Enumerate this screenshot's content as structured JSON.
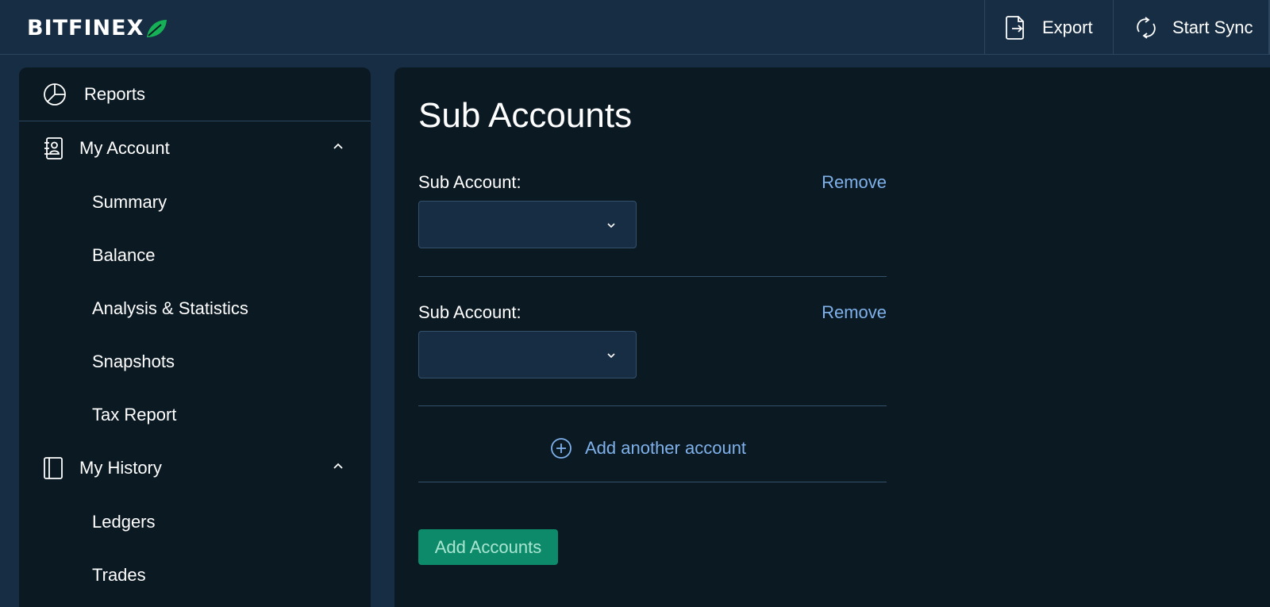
{
  "brand": {
    "name": "BITFINEX",
    "leaf_color": "#16b157"
  },
  "topbar": {
    "export_label": "Export",
    "sync_label": "Start Sync"
  },
  "sidebar": {
    "reports_label": "Reports",
    "sections": [
      {
        "label": "My Account",
        "icon": "contact-book-icon",
        "expanded": true,
        "items": [
          "Summary",
          "Balance",
          "Analysis & Statistics",
          "Snapshots",
          "Tax Report"
        ]
      },
      {
        "label": "My History",
        "icon": "notebook-icon",
        "expanded": true,
        "items": [
          "Ledgers",
          "Trades"
        ]
      }
    ]
  },
  "main": {
    "title": "Sub Accounts",
    "sub_accounts": [
      {
        "label": "Sub Account:",
        "remove_label": "Remove",
        "selected_value": ""
      },
      {
        "label": "Sub Account:",
        "remove_label": "Remove",
        "selected_value": ""
      }
    ],
    "add_another_label": "Add another account",
    "submit_label": "Add Accounts"
  },
  "colors": {
    "background": "#172d44",
    "panel": "#0b1923",
    "link": "#7fb1ea",
    "primary_button": "#0d8a6a"
  }
}
